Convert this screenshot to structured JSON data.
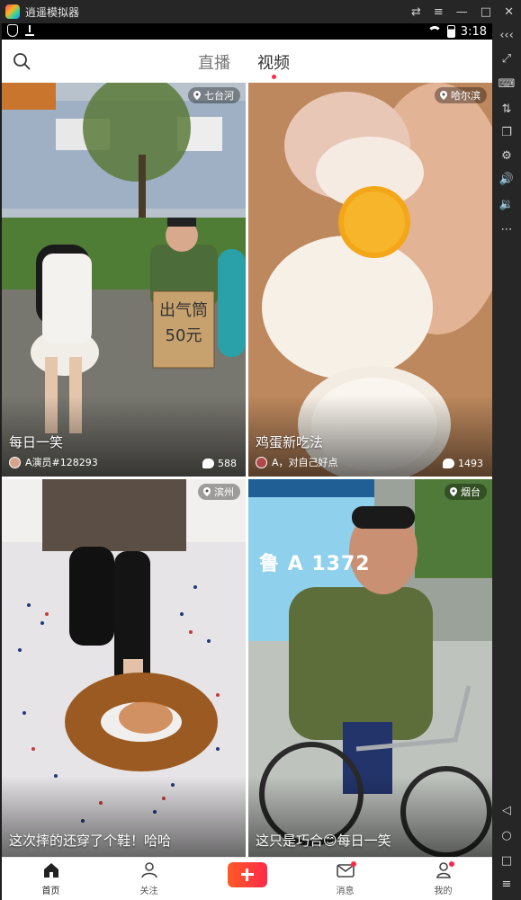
{
  "emulator": {
    "title": "逍遥模拟器",
    "controls": [
      "⇄",
      "≡",
      "—",
      "□",
      "✕"
    ],
    "side_buttons": [
      "‹‹‹",
      "⤢",
      "⌨",
      "⇅",
      "❐",
      "⚙",
      "🔊",
      "🔉",
      "⋯",
      "◁",
      "○",
      "□",
      "≡"
    ]
  },
  "status_bar": {
    "time": "3:18"
  },
  "header": {
    "tabs": [
      {
        "label": "直播",
        "active": false
      },
      {
        "label": "视频",
        "active": true
      }
    ]
  },
  "feed": [
    {
      "location": "七台河",
      "title": "每日一笑",
      "author": "A演员#128293",
      "comments": "588",
      "sign_text": "出气筒\n50元"
    },
    {
      "location": "哈尔滨",
      "title": "鸡蛋新吃法",
      "author": "A，对自己好点",
      "comments": "1493"
    },
    {
      "location": "滨州",
      "title": "这次摔的还穿了个鞋！哈哈",
      "author": "",
      "comments": ""
    },
    {
      "location": "烟台",
      "title": "这只是巧合😊每日一笑",
      "author": "",
      "comments": "",
      "bus_text": "鲁 A 1372"
    }
  ],
  "bottom_nav": [
    {
      "label": "首页",
      "icon": "home-icon",
      "active": true,
      "badge": false
    },
    {
      "label": "关注",
      "icon": "follow-icon",
      "active": false,
      "badge": false
    },
    {
      "label": "",
      "icon": "publish-plus-icon",
      "active": false,
      "badge": false
    },
    {
      "label": "消息",
      "icon": "message-icon",
      "active": false,
      "badge": true
    },
    {
      "label": "我的",
      "icon": "profile-icon",
      "active": false,
      "badge": true
    }
  ],
  "colors": {
    "accent": "#ff2a4a",
    "publish_gradient_start": "#ff5a26"
  }
}
